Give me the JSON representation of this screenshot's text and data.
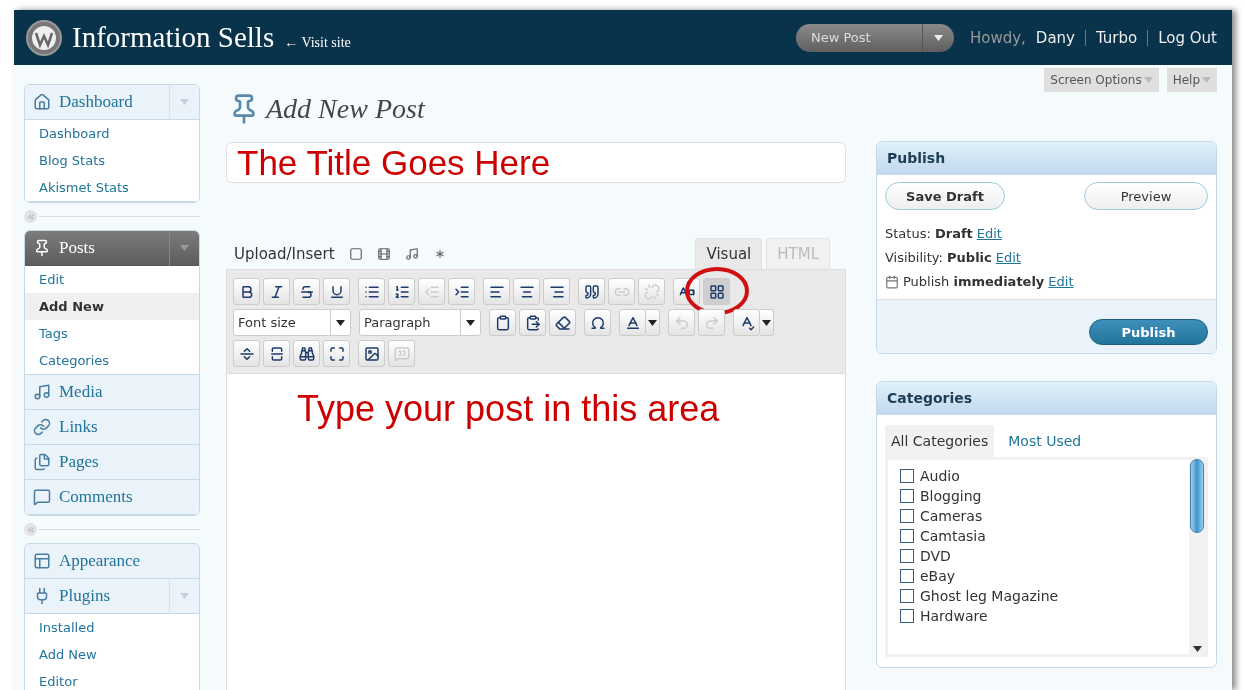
{
  "header": {
    "site_title": "Information Sells",
    "visit_link": "← Visit site",
    "favorites": "New Post",
    "greeting": "Howdy,",
    "user": "Dany",
    "links": [
      "Turbo",
      "Log Out"
    ]
  },
  "screen_meta": [
    "Screen Options",
    "Help"
  ],
  "sidebar": {
    "groups": [
      {
        "items": [
          {
            "label": "Dashboard",
            "current": false,
            "expanded": true,
            "children": [
              {
                "label": "Dashboard",
                "selected": false
              },
              {
                "label": "Blog Stats",
                "selected": false
              },
              {
                "label": "Akismet Stats",
                "selected": false
              }
            ]
          }
        ]
      },
      {
        "items": [
          {
            "label": "Posts",
            "current": true,
            "expanded": true,
            "children": [
              {
                "label": "Edit",
                "selected": false
              },
              {
                "label": "Add New",
                "selected": true
              },
              {
                "label": "Tags",
                "selected": false
              },
              {
                "label": "Categories",
                "selected": false
              }
            ]
          },
          {
            "label": "Media",
            "current": false,
            "expanded": false
          },
          {
            "label": "Links",
            "current": false,
            "expanded": false
          },
          {
            "label": "Pages",
            "current": false,
            "expanded": false
          },
          {
            "label": "Comments",
            "current": false,
            "expanded": false
          }
        ]
      },
      {
        "items": [
          {
            "label": "Appearance",
            "current": false,
            "expanded": false
          },
          {
            "label": "Plugins",
            "current": false,
            "expanded": true,
            "children": [
              {
                "label": "Installed",
                "selected": false
              },
              {
                "label": "Add New",
                "selected": false
              },
              {
                "label": "Editor",
                "selected": false
              }
            ]
          }
        ]
      }
    ]
  },
  "page_title": "Add New Post",
  "post_title": "The Title Goes Here",
  "upload_label": "Upload/Insert",
  "editor_tabs": [
    {
      "label": "Visual",
      "selected": true
    },
    {
      "label": "HTML",
      "selected": false
    }
  ],
  "toolbar": {
    "rows": [
      [
        [
          {
            "kind": "button",
            "disabled": false,
            "pressed": false,
            "highlighted": false
          },
          {
            "kind": "button",
            "disabled": false,
            "pressed": false,
            "highlighted": false
          },
          {
            "kind": "button",
            "disabled": false,
            "pressed": false,
            "highlighted": false
          },
          {
            "kind": "button",
            "disabled": false,
            "pressed": false,
            "highlighted": false
          }
        ],
        [
          {
            "kind": "button",
            "disabled": false,
            "pressed": false,
            "highlighted": false
          },
          {
            "kind": "button",
            "disabled": false,
            "pressed": false,
            "highlighted": false
          },
          {
            "kind": "button",
            "disabled": true,
            "pressed": false,
            "highlighted": false
          },
          {
            "kind": "button",
            "disabled": false,
            "pressed": false,
            "highlighted": false
          }
        ],
        [
          {
            "kind": "button",
            "disabled": false,
            "pressed": false,
            "highlighted": false
          },
          {
            "kind": "button",
            "disabled": false,
            "pressed": false,
            "highlighted": false
          },
          {
            "kind": "button",
            "disabled": false,
            "pressed": false,
            "highlighted": false
          }
        ],
        [
          {
            "kind": "button",
            "disabled": false,
            "pressed": false,
            "highlighted": false
          },
          {
            "kind": "button",
            "disabled": true,
            "pressed": false,
            "highlighted": false
          },
          {
            "kind": "button",
            "disabled": true,
            "pressed": false,
            "highlighted": false
          }
        ],
        [
          {
            "kind": "button",
            "disabled": false,
            "pressed": false,
            "highlighted": false
          },
          {
            "kind": "button",
            "disabled": false,
            "pressed": true,
            "highlighted": true
          }
        ]
      ],
      [
        [
          {
            "kind": "select",
            "value": "Font size"
          }
        ],
        [
          {
            "kind": "select",
            "value": "Paragraph"
          }
        ],
        [
          {
            "kind": "button",
            "disabled": false,
            "pressed": false,
            "highlighted": false
          },
          {
            "kind": "button",
            "disabled": false,
            "pressed": false,
            "highlighted": false
          },
          {
            "kind": "button",
            "disabled": false,
            "pressed": false,
            "highlighted": false
          }
        ],
        [
          {
            "kind": "button",
            "disabled": false,
            "pressed": false,
            "highlighted": false
          }
        ],
        [
          {
            "kind": "split",
            "disabled": false,
            "pressed": false,
            "highlighted": false
          }
        ],
        [
          {
            "kind": "button",
            "disabled": true,
            "pressed": false,
            "highlighted": false
          },
          {
            "kind": "button",
            "disabled": true,
            "pressed": false,
            "highlighted": false
          }
        ],
        [
          {
            "kind": "split",
            "disabled": false,
            "pressed": false,
            "highlighted": false
          }
        ]
      ],
      [
        [
          {
            "kind": "button",
            "disabled": false,
            "pressed": false,
            "highlighted": false
          },
          {
            "kind": "button",
            "disabled": false,
            "pressed": false,
            "highlighted": false
          },
          {
            "kind": "button",
            "disabled": false,
            "pressed": false,
            "highlighted": false
          },
          {
            "kind": "button",
            "disabled": false,
            "pressed": false,
            "highlighted": false
          }
        ],
        [
          {
            "kind": "button",
            "disabled": false,
            "pressed": false,
            "highlighted": false
          },
          {
            "kind": "button",
            "disabled": true,
            "pressed": false,
            "highlighted": false
          }
        ]
      ]
    ]
  },
  "editor_content": "Type your post in this area",
  "publish": {
    "title": "Publish",
    "save_draft": "Save Draft",
    "preview": "Preview",
    "lines": [
      {
        "kind": "text",
        "text": "Status: **Draft**",
        "link": "Edit"
      },
      {
        "kind": "text",
        "text": "Visibility: **Public**",
        "link": "Edit"
      },
      {
        "kind": "calendar",
        "text": "Publish **immediately**",
        "link": "Edit"
      }
    ],
    "button": "Publish"
  },
  "categories": {
    "title": "Categories",
    "tabs": [
      {
        "label": "All Categories",
        "selected": true
      },
      {
        "label": "Most Used",
        "selected": false
      }
    ],
    "items": [
      {
        "label": "Audio",
        "checked": false
      },
      {
        "label": "Blogging",
        "checked": false
      },
      {
        "label": "Cameras",
        "checked": false
      },
      {
        "label": "Camtasia",
        "checked": false
      },
      {
        "label": "DVD",
        "checked": false
      },
      {
        "label": "eBay",
        "checked": false
      },
      {
        "label": "Ghost leg Magazine",
        "checked": false
      },
      {
        "label": "Hardware",
        "checked": false
      }
    ]
  }
}
